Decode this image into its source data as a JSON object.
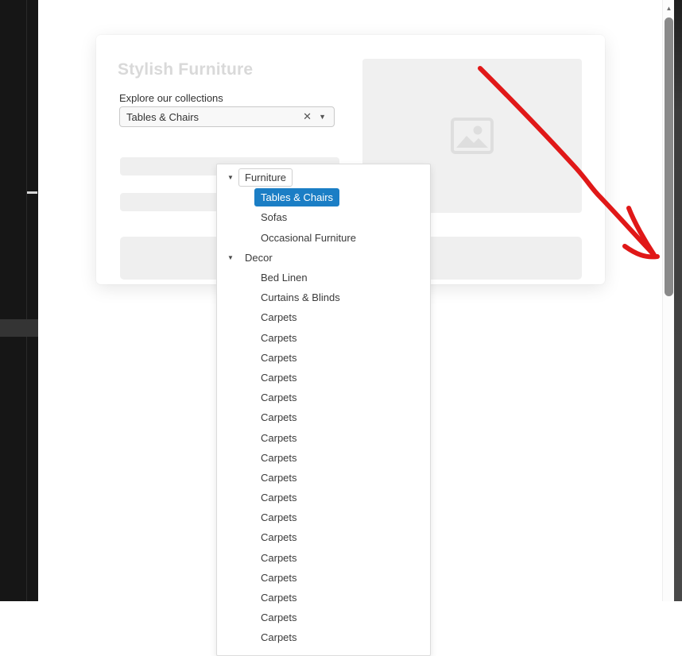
{
  "modal": {
    "title": "Stylish Furniture",
    "collections_label": "Explore our collections"
  },
  "combobox": {
    "value": "Tables & Chairs",
    "clear_icon": "✕",
    "caret_icon": "▼"
  },
  "tree": {
    "expander_icon": "▼",
    "nodes": [
      {
        "label": "Furniture",
        "level": 0,
        "expanded": true,
        "focused": true
      },
      {
        "label": "Tables & Chairs",
        "level": 1,
        "selected": true
      },
      {
        "label": "Sofas",
        "level": 1
      },
      {
        "label": "Occasional Furniture",
        "level": 1
      },
      {
        "label": "Decor",
        "level": 0,
        "expanded": true
      },
      {
        "label": "Bed Linen",
        "level": 1
      },
      {
        "label": "Curtains & Blinds",
        "level": 1
      },
      {
        "label": "Carpets",
        "level": 1
      },
      {
        "label": "Carpets",
        "level": 1
      },
      {
        "label": "Carpets",
        "level": 1
      },
      {
        "label": "Carpets",
        "level": 1
      },
      {
        "label": "Carpets",
        "level": 1
      },
      {
        "label": "Carpets",
        "level": 1
      },
      {
        "label": "Carpets",
        "level": 1
      },
      {
        "label": "Carpets",
        "level": 1
      },
      {
        "label": "Carpets",
        "level": 1
      },
      {
        "label": "Carpets",
        "level": 1
      },
      {
        "label": "Carpets",
        "level": 1
      },
      {
        "label": "Carpets",
        "level": 1
      },
      {
        "label": "Carpets",
        "level": 1
      },
      {
        "label": "Carpets",
        "level": 1
      },
      {
        "label": "Carpets",
        "level": 1
      },
      {
        "label": "Carpets",
        "level": 1
      },
      {
        "label": "Carpets",
        "level": 1
      }
    ]
  },
  "scrollbar": {
    "up_arrow_icon": "▲"
  },
  "colors": {
    "selection_bg": "#1b7ec5",
    "selection_text": "#ffffff",
    "title_text": "#d9d9d9",
    "item_text": "#3a3a3a",
    "annotation_arrow": "#e01818",
    "sidebar_bg": "#161616",
    "skeleton_gray": "#efefef"
  }
}
